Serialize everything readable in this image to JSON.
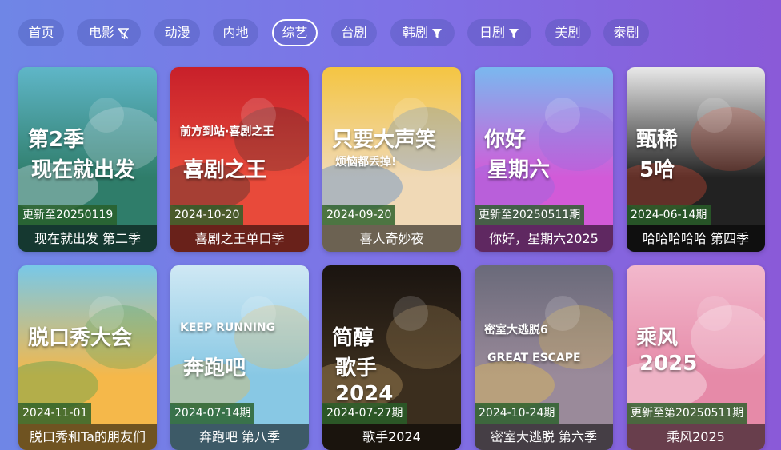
{
  "nav": {
    "tabs": [
      {
        "label": "首页",
        "icon": null
      },
      {
        "label": "电影",
        "icon": "filter-off-icon"
      },
      {
        "label": "动漫",
        "icon": null
      },
      {
        "label": "内地",
        "icon": null
      },
      {
        "label": "综艺",
        "icon": null,
        "active": true
      },
      {
        "label": "台剧",
        "icon": null
      },
      {
        "label": "韩剧",
        "icon": "filter-icon"
      },
      {
        "label": "日剧",
        "icon": "filter-icon"
      },
      {
        "label": "美剧",
        "icon": null
      },
      {
        "label": "泰剧",
        "icon": null
      }
    ]
  },
  "cards": [
    {
      "badge": "更新至20250119",
      "title": "现在就出发 第二季",
      "poster_text": [
        "第2季",
        "现在就出发"
      ],
      "poster_colors": [
        "#5fb6c8",
        "#2f7d6a",
        "#dfe9ef"
      ]
    },
    {
      "badge": "2024-10-20",
      "title": "喜剧之王单口季",
      "poster_text": [
        "前方到站·喜剧之王",
        "喜剧之王"
      ],
      "poster_colors": [
        "#c8202a",
        "#e84a3a",
        "#2a2a2a"
      ]
    },
    {
      "badge": "2024-09-20",
      "title": "喜人奇妙夜",
      "poster_text": [
        "只要大声笑",
        "烦恼都丢掉!"
      ],
      "poster_colors": [
        "#f4c542",
        "#f0d9b6",
        "#3a79c8"
      ]
    },
    {
      "badge": "更新至20250511期",
      "title": "你好，星期六2025",
      "poster_text": [
        "你好",
        "星期六"
      ],
      "poster_colors": [
        "#7ab8ef",
        "#d25ad8",
        "#8d6ae0"
      ]
    },
    {
      "badge": "2024-06-14期",
      "title": "哈哈哈哈哈 第四季",
      "poster_text": [
        "甄稀",
        "5哈"
      ],
      "poster_colors": [
        "#e9e9e9",
        "#222222",
        "#d94a34"
      ]
    },
    {
      "badge": "2024-11-01",
      "title": "脱口秀和Ta的朋友们",
      "poster_text": [
        "脱口秀大会"
      ],
      "poster_colors": [
        "#78c8e8",
        "#f5b84a",
        "#3a9a4a"
      ]
    },
    {
      "badge": "2024-07-14期",
      "title": "奔跑吧 第八季",
      "poster_text": [
        "KEEP RUNNING",
        "奔跑吧"
      ],
      "poster_colors": [
        "#cfe8f4",
        "#88c8e4",
        "#f0b94a"
      ]
    },
    {
      "badge": "2024-07-27期",
      "title": "歌手2024",
      "poster_text": [
        "简醇",
        "歌手",
        "2024"
      ],
      "poster_colors": [
        "#1a1410",
        "#3b2e1e",
        "#c8a46a"
      ]
    },
    {
      "badge": "2024-10-24期",
      "title": "密室大逃脱 第六季",
      "poster_text": [
        "密室大逃脱6",
        "GREAT ESCAPE"
      ],
      "poster_colors": [
        "#6a6a7a",
        "#9a8a9a",
        "#f0c844"
      ]
    },
    {
      "badge": "更新至第20250511期",
      "title": "乘风2025",
      "poster_text": [
        "乘风",
        "2025"
      ],
      "poster_colors": [
        "#f2b8cc",
        "#e68aa8",
        "#ffffff"
      ]
    }
  ]
}
